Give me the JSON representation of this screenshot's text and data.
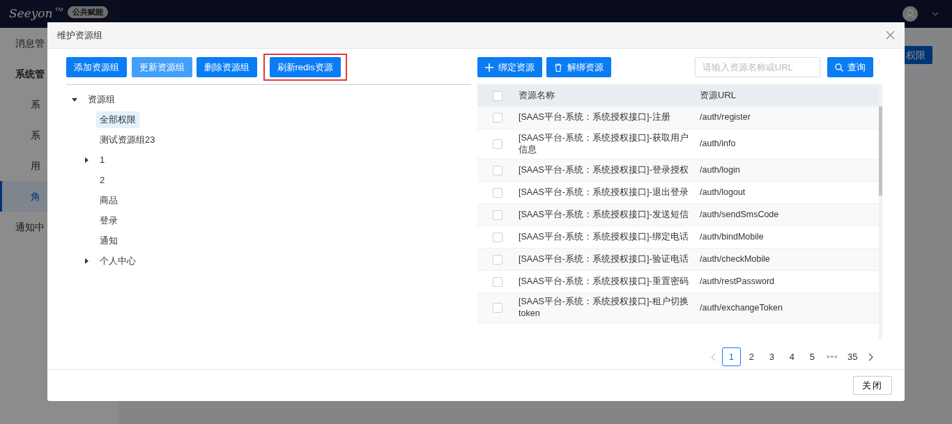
{
  "app": {
    "logo": "Seeyon",
    "trademark": "TM",
    "badge": "公共赋能",
    "main_button": "权限",
    "sidebar": [
      {
        "label": "消息管",
        "selected": false
      },
      {
        "label": "系统管",
        "selected": false,
        "children": [
          {
            "label": "系",
            "selected": false
          },
          {
            "label": "系",
            "selected": false
          },
          {
            "label": "用",
            "selected": false
          },
          {
            "label": "角",
            "selected": true
          }
        ]
      },
      {
        "label": "通知中",
        "selected": false
      }
    ]
  },
  "modal": {
    "title": "维护资源组",
    "group_buttons": [
      {
        "label": "添加资源组",
        "hover": false,
        "marked": false
      },
      {
        "label": "更新资源组",
        "hover": true,
        "marked": false
      },
      {
        "label": "删除资源组",
        "hover": false,
        "marked": false
      },
      {
        "label": "刷新redis资源",
        "hover": false,
        "marked": true
      }
    ],
    "tree": [
      {
        "label": "资源组",
        "expanded": true,
        "selected": false,
        "children": [
          {
            "label": "全部权限",
            "selected": true
          },
          {
            "label": "测试资源组23",
            "selected": false
          },
          {
            "label": "1",
            "expanded": false,
            "selected": false
          },
          {
            "label": "2",
            "selected": false
          },
          {
            "label": "商品",
            "selected": false
          },
          {
            "label": "登录",
            "selected": false
          },
          {
            "label": "通知",
            "selected": false
          },
          {
            "label": "个人中心",
            "expanded": false,
            "selected": false
          }
        ]
      }
    ],
    "resource_buttons": [
      {
        "label": "绑定资源",
        "kind": "plus"
      },
      {
        "label": "解绑资源",
        "kind": "trash"
      }
    ],
    "search": {
      "placeholder": "请输入资源名称或URL"
    },
    "search_button": "查询",
    "table": {
      "all_checked": false,
      "columns": [
        "资源名称",
        "资源URL"
      ],
      "rows": [
        {
          "name": "[SAAS平台-系统：系统授权接口]-注册",
          "url": "/auth/register",
          "checked": false
        },
        {
          "name": "[SAAS平台-系统：系统授权接口]-获取用户信息",
          "url": "/auth/info",
          "checked": false
        },
        {
          "name": "[SAAS平台-系统：系统授权接口]-登录授权",
          "url": "/auth/login",
          "checked": false
        },
        {
          "name": "[SAAS平台-系统：系统授权接口]-退出登录",
          "url": "/auth/logout",
          "checked": false
        },
        {
          "name": "[SAAS平台-系统：系统授权接口]-发送短信",
          "url": "/auth/sendSmsCode",
          "checked": false
        },
        {
          "name": "[SAAS平台-系统：系统授权接口]-绑定电话",
          "url": "/auth/bindMobile",
          "checked": false
        },
        {
          "name": "[SAAS平台-系统：系统授权接口]-验证电话",
          "url": "/auth/checkMobile",
          "checked": false
        },
        {
          "name": "[SAAS平台-系统：系统授权接口]-重置密码",
          "url": "/auth/restPassword",
          "checked": false
        },
        {
          "name": "[SAAS平台-系统：系统授权接口]-租户切换token",
          "url": "/auth/exchangeToken",
          "checked": false
        }
      ]
    },
    "pagination": {
      "prev_disabled": true,
      "next_disabled": false,
      "pages": [
        {
          "label": "1",
          "selected": true,
          "kind": "page"
        },
        {
          "label": "2",
          "selected": false,
          "kind": "page"
        },
        {
          "label": "3",
          "selected": false,
          "kind": "page"
        },
        {
          "label": "4",
          "selected": false,
          "kind": "page"
        },
        {
          "label": "5",
          "selected": false,
          "kind": "page"
        },
        {
          "label": "•••",
          "selected": false,
          "kind": "ellipsis"
        },
        {
          "label": "35",
          "selected": false,
          "kind": "page"
        }
      ]
    },
    "close_button": "关闭"
  }
}
